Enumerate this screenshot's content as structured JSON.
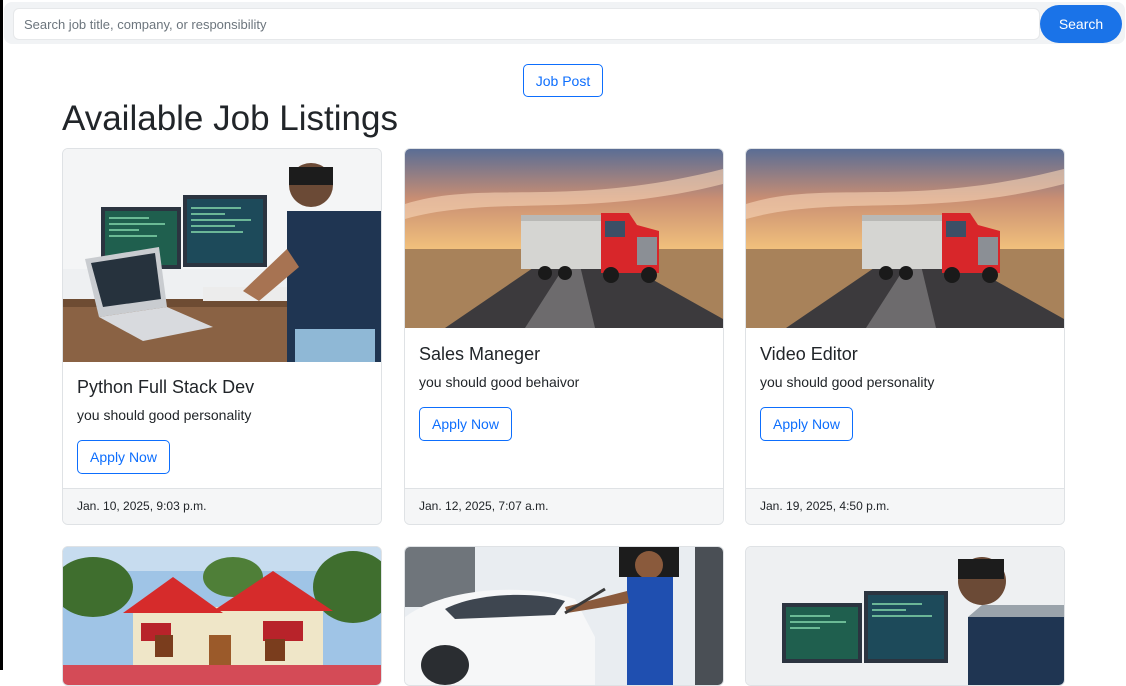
{
  "search": {
    "placeholder": "Search job title, company, or responsibility",
    "button_label": "Search"
  },
  "job_post_label": "Job Post",
  "page_title": "Available Job Listings",
  "jobs": [
    {
      "title": "Python Full Stack Dev",
      "description": "you should good personality",
      "apply_label": "Apply Now",
      "posted": "Jan. 10, 2025, 9:03 p.m.",
      "image": "developer-workstation-photo"
    },
    {
      "title": "Sales Maneger",
      "description": "you should good behaivor",
      "apply_label": "Apply Now",
      "posted": "Jan. 12, 2025, 7:07 a.m.",
      "image": "red-truck-highway-photo"
    },
    {
      "title": "Video Editor",
      "description": "you should good personality",
      "apply_label": "Apply Now",
      "posted": "Jan. 19, 2025, 4:50 p.m.",
      "image": "red-truck-highway-photo"
    },
    {
      "image": "red-house-photo"
    },
    {
      "image": "car-wash-worker-photo"
    },
    {
      "image": "developer-monitors-photo"
    }
  ],
  "colors": {
    "primary": "#0d6efd",
    "search_button": "#1a73e8",
    "footer_bg": "#f5f6f7"
  }
}
